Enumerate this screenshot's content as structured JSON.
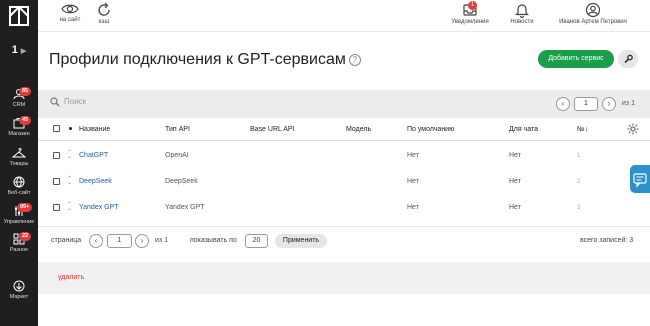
{
  "sidebar": {
    "project": "1",
    "items": [
      {
        "label": "CRM",
        "icon": "crm-icon",
        "badge": "85"
      },
      {
        "label": "Магазин",
        "icon": "shop-icon",
        "badge": "45"
      },
      {
        "label": "Товары",
        "icon": "hanger-icon",
        "badge": ""
      },
      {
        "label": "Веб-сайт",
        "icon": "website-icon",
        "badge": ""
      },
      {
        "label": "Управление",
        "icon": "control-icon",
        "badge": "99+"
      },
      {
        "label": "Разное",
        "icon": "misc-icon",
        "badge": "22"
      },
      {
        "label": "Маркет",
        "icon": "market-icon",
        "badge": ""
      }
    ]
  },
  "topbar": {
    "site_label": "на сайт",
    "cache_label": "кэш",
    "notifications_label": "Уведомления",
    "notifications_badge": "1",
    "news_label": "Новости",
    "user_name": "Иванов Артем Петрович"
  },
  "page": {
    "title": "Профили подключения к GPT-сервисам",
    "help_glyph": "?",
    "add_button": "Добавить сервис"
  },
  "search": {
    "placeholder": "Поиск",
    "page": "1",
    "of": "из 1"
  },
  "table": {
    "headers": {
      "name": "Название",
      "api_type": "Тип API",
      "base_url": "Base URL API",
      "model": "Модель",
      "default": "По умолчанию",
      "for_chat": "Для чата",
      "num": "№↓"
    },
    "rows": [
      {
        "name": "ChatGPT",
        "api_type": "OpenAI",
        "base_url": "",
        "model": "",
        "default": "Нет",
        "for_chat": "Нет",
        "num": "1"
      },
      {
        "name": "DeepSeek",
        "api_type": "DeepSeek",
        "base_url": "",
        "model": "",
        "default": "Нет",
        "for_chat": "Нет",
        "num": "2"
      },
      {
        "name": "Yandex GPT",
        "api_type": "Yandex GPT",
        "base_url": "",
        "model": "",
        "default": "Нет",
        "for_chat": "Нет",
        "num": "3"
      }
    ]
  },
  "pager": {
    "page_label": "страница",
    "page": "1",
    "of": "из 1",
    "show_label": "показывать по",
    "per_page": "20",
    "apply": "Применить",
    "total": "всего записей: 3"
  },
  "actions": {
    "delete": "удалить"
  },
  "colors": {
    "sidebar": "#1f1f1f",
    "accent_green": "#1a9e4a",
    "badge_red": "#e23b3b",
    "link_blue": "#1f5fa8",
    "chat_tab": "#2b91c9"
  }
}
